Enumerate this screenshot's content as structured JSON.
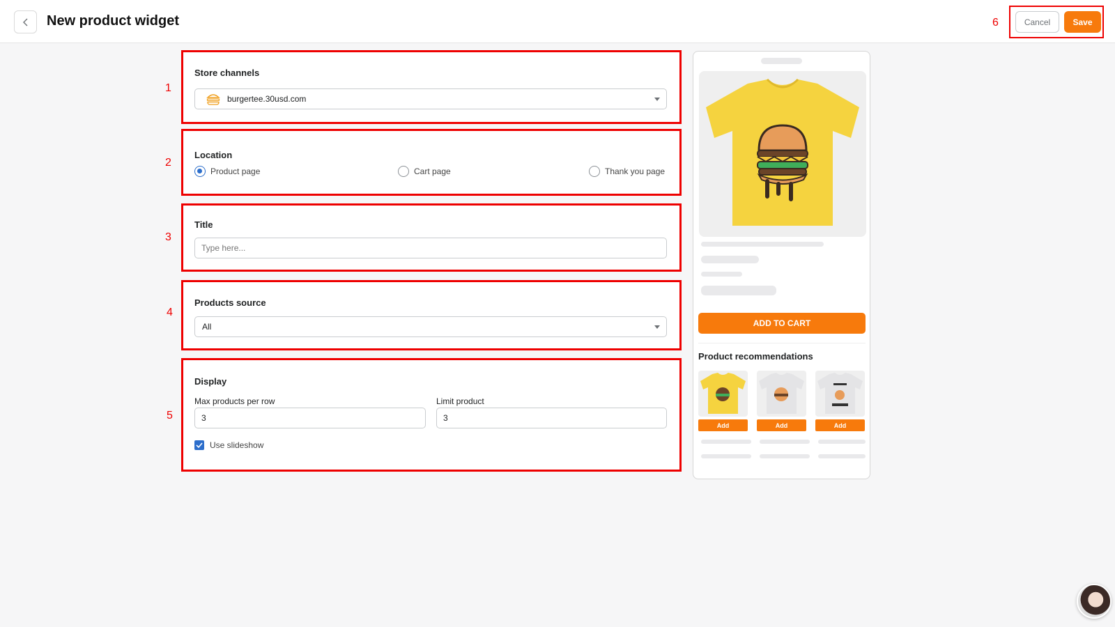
{
  "header": {
    "title": "New product widget",
    "cancel_label": "Cancel",
    "save_label": "Save",
    "annotation": "6"
  },
  "store_channels": {
    "annotation": "1",
    "label": "Store channels",
    "selected": "burgertee.30usd.com"
  },
  "location": {
    "annotation": "2",
    "label": "Location",
    "options": [
      {
        "label": "Product page",
        "selected": true
      },
      {
        "label": "Cart page",
        "selected": false
      },
      {
        "label": "Thank you page",
        "selected": false
      }
    ]
  },
  "title_section": {
    "annotation": "3",
    "label": "Title",
    "placeholder": "Type here...",
    "value": ""
  },
  "products_source": {
    "annotation": "4",
    "label": "Products source",
    "selected": "All"
  },
  "display": {
    "annotation": "5",
    "label": "Display",
    "max_per_row_label": "Max products per row",
    "max_per_row_value": "3",
    "limit_label": "Limit product",
    "limit_value": "3",
    "slideshow_label": "Use slideshow",
    "slideshow_checked": true
  },
  "preview": {
    "add_to_cart_label": "ADD TO CART",
    "recommendations_title": "Product recommendations",
    "items": [
      {
        "add_label": "Add",
        "shirt_color": "#f5d33f"
      },
      {
        "add_label": "Add",
        "shirt_color": "#e4e4e6"
      },
      {
        "add_label": "Add",
        "shirt_color": "#e4e4e6"
      }
    ]
  },
  "colors": {
    "accent": "#f77a0c",
    "radio_selected": "#2c6ecb",
    "annotation_red": "#e00"
  }
}
